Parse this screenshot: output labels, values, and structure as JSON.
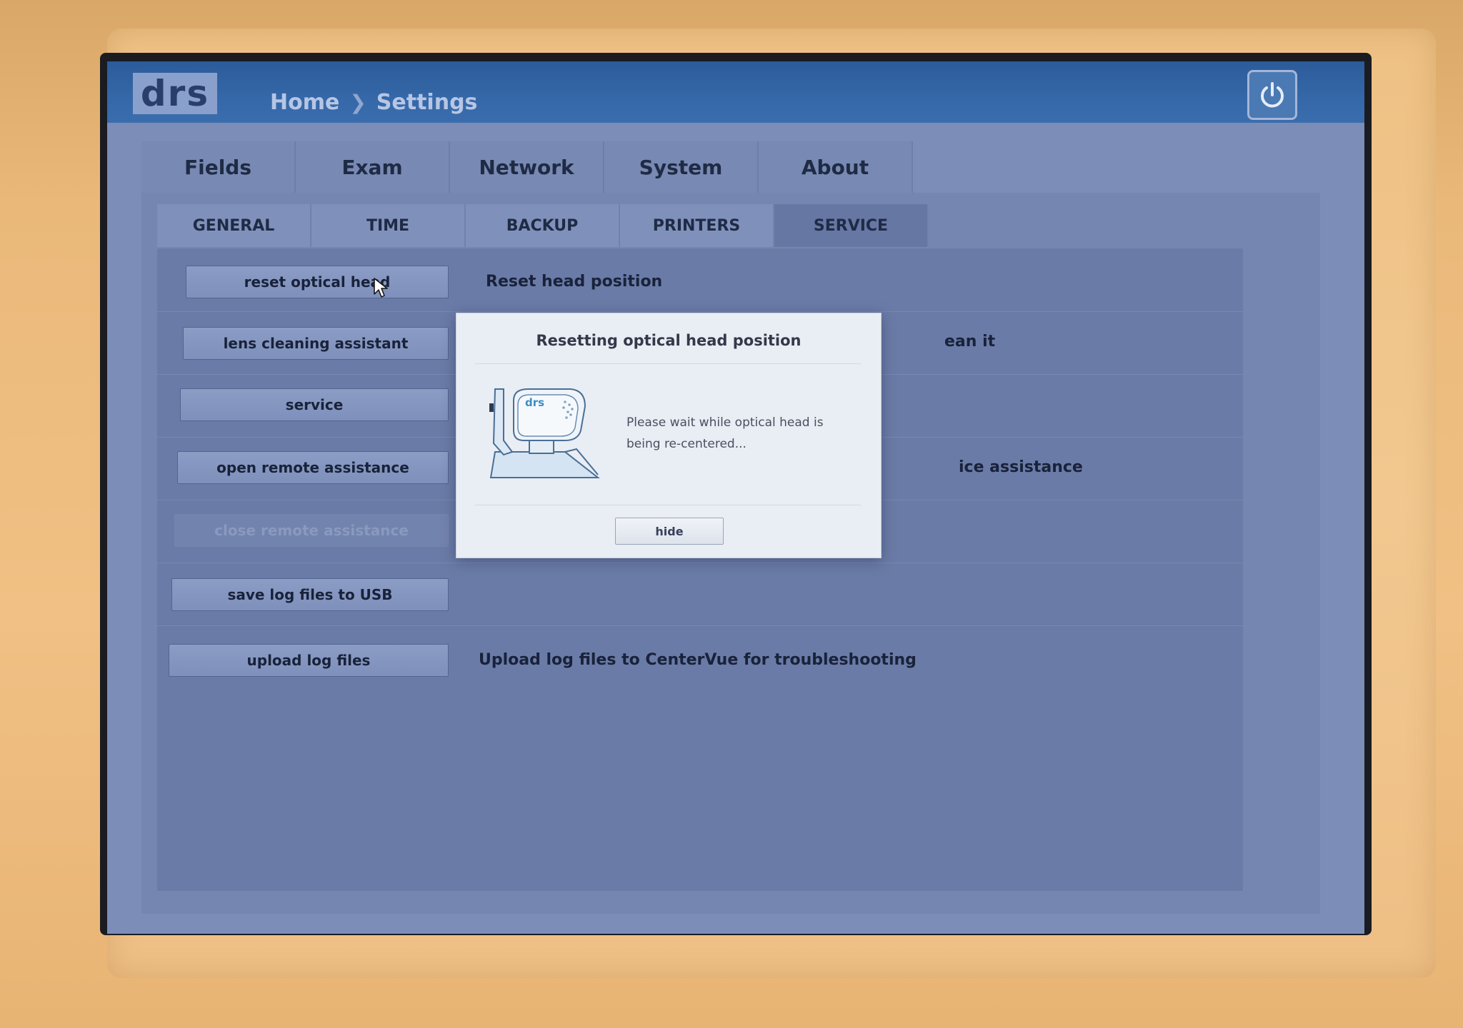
{
  "header": {
    "logo": "drs",
    "breadcrumb": [
      "Home",
      "Settings"
    ],
    "separator": "❯",
    "power_icon": "power-icon"
  },
  "main_tabs": [
    "Fields",
    "Exam",
    "Network",
    "System",
    "About"
  ],
  "sub_tabs": [
    "GENERAL",
    "TIME",
    "BACKUP",
    "PRINTERS",
    "SERVICE"
  ],
  "active_sub_tab": "SERVICE",
  "service_rows": [
    {
      "button": "reset optical head",
      "description": "Reset head position",
      "enabled": true
    },
    {
      "button": "lens cleaning assistant",
      "description": "ean it",
      "enabled": true
    },
    {
      "button": "service",
      "description": "",
      "enabled": true
    },
    {
      "button": "open remote assistance",
      "description": "ice assistance",
      "enabled": true
    },
    {
      "button": "close remote assistance",
      "description": "",
      "enabled": false
    },
    {
      "button": "save log files to USB",
      "description": "",
      "enabled": true
    },
    {
      "button": "upload log files",
      "description": "Upload log files to CenterVue for troubleshooting",
      "enabled": true
    }
  ],
  "modal": {
    "title": "Resetting optical head position",
    "message": "Please wait while optical head is being re-centered...",
    "device_logo": "drs",
    "device_icon": "optical-head-device-icon",
    "hide_label": "hide"
  },
  "colors": {
    "topbar": "#3568a8",
    "screen_bg": "#7c8db8",
    "modal_bg": "#e9edf4",
    "device_accent": "#3a8fc4"
  }
}
